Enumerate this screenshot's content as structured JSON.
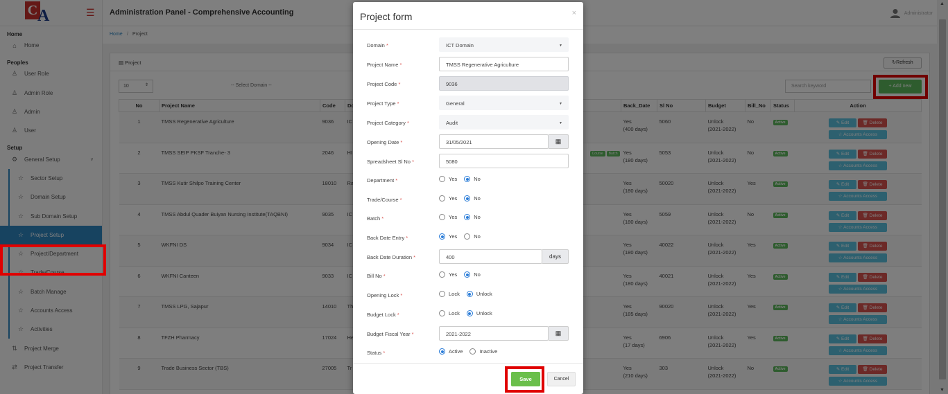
{
  "app": {
    "title": "Administration Panel - Comprehensive Accounting",
    "user": "Administrator",
    "logo_c": "C",
    "logo_a": "A"
  },
  "breadcrumb": {
    "home": "Home",
    "sep": "/",
    "current": "Project"
  },
  "sidebar": {
    "sections": {
      "home": "Home",
      "peoples": "Peoples",
      "setup": "Setup"
    },
    "items": {
      "home": "Home",
      "user_role": "User Role",
      "admin_role": "Admin Role",
      "admin": "Admin",
      "user": "User",
      "general_setup": "General Setup",
      "sector_setup": "Sector Setup",
      "domain_setup": "Domain Setup",
      "sub_domain_setup": "Sub Domain Setup",
      "project_setup": "Project Setup",
      "project_department": "Project/Department",
      "trade_course": "Trade/Course",
      "batch_manage": "Batch Manage",
      "accounts_access": "Accounts Access",
      "activities": "Activities",
      "project_merge": "Project Merge",
      "project_transfer": "Project Transfer"
    }
  },
  "panel": {
    "title": "Project",
    "refresh": "Refresh",
    "page_size": "10",
    "domain_select": "-- Select Domain --",
    "search_placeholder": "Search keyword",
    "add_new": "+ Add new"
  },
  "table": {
    "headers": {
      "no": "No",
      "name": "Project Name",
      "code": "Code",
      "do": "Do",
      "back_date": "Back_Date",
      "sl_no": "Sl No",
      "budget": "Budget",
      "bill_no": "Bill_No",
      "status": "Status",
      "action": "Action"
    },
    "buttons": {
      "edit": "Edit",
      "delete": "Delete",
      "accounts": "Accounts Access"
    },
    "rows": [
      {
        "no": "1",
        "name": "TMSS Regenerative Agriculture",
        "code": "9036",
        "do": "IC",
        "back": "Yes",
        "days": "(400 days)",
        "sl": "5060",
        "budget": "Unlock",
        "fy": "(2021-2022)",
        "bill": "No",
        "status": "Active"
      },
      {
        "no": "2",
        "name": "TMSS SEIP PKSF Tranche- 3",
        "code": "2046",
        "do": "HI",
        "tag1": "Course",
        "tag2": "Batch",
        "back": "Yes",
        "days": "(180 days)",
        "sl": "5053",
        "budget": "Unlock",
        "fy": "(2021-2022)",
        "bill": "No",
        "status": "Active"
      },
      {
        "no": "3",
        "name": "TMSS Kutir Shilpo Training Center",
        "code": "18010",
        "do": "Ra",
        "back": "Yes",
        "days": "(180 days)",
        "sl": "50020",
        "budget": "Unlock",
        "fy": "(2021-2022)",
        "bill": "Yes",
        "status": "Active"
      },
      {
        "no": "4",
        "name": "TMSS Abdul Quader Buiyan Nursing Institute(TAQBNI)",
        "code": "9035",
        "do": "IC",
        "back": "Yes",
        "days": "(180 days)",
        "sl": "5059",
        "budget": "Unlock",
        "fy": "(2021-2022)",
        "bill": "No",
        "status": "Active"
      },
      {
        "no": "5",
        "name": "WKFNI DS",
        "code": "9034",
        "do": "IC",
        "back": "Yes",
        "days": "(180 days)",
        "sl": "40022",
        "budget": "Unlock",
        "fy": "(2021-2022)",
        "bill": "Yes",
        "status": "Active"
      },
      {
        "no": "6",
        "name": "WKFNI Canteen",
        "code": "9033",
        "do": "IC",
        "back": "Yes",
        "days": "(180 days)",
        "sl": "40021",
        "budget": "Unlock",
        "fy": "(2021-2022)",
        "bill": "Yes",
        "status": "Active"
      },
      {
        "no": "7",
        "name": "TMSS LPG, Sajapur",
        "code": "14010",
        "do": "Th",
        "back": "Yes",
        "days": "(185 days)",
        "sl": "90020",
        "budget": "Unlock",
        "fy": "(2021-2022)",
        "bill": "Yes",
        "status": "Active"
      },
      {
        "no": "8",
        "name": "TFZH Pharmacy",
        "code": "17024",
        "do": "He",
        "back": "Yes",
        "days": "(17 days)",
        "sl": "6906",
        "budget": "Unlock",
        "fy": "(2021-2022)",
        "bill": "Yes",
        "status": "Active"
      },
      {
        "no": "9",
        "name": "Trade Business Sector (TBS)",
        "code": "27005",
        "do": "Tr",
        "back": "Yes",
        "days": "(210 days)",
        "sl": "303",
        "budget": "Unlock",
        "fy": "(2021-2022)",
        "bill": "No",
        "status": "Active"
      }
    ]
  },
  "modal": {
    "title": "Project form",
    "close": "×",
    "fields": {
      "domain": {
        "label": "Domain",
        "value": "ICT Domain"
      },
      "project_name": {
        "label": "Project Name",
        "value": "TMSS Regenerative Agriculture"
      },
      "project_code": {
        "label": "Project Code",
        "value": "9036"
      },
      "project_type": {
        "label": "Project Type",
        "value": "General"
      },
      "project_category": {
        "label": "Project Category",
        "value": "Audit"
      },
      "opening_date": {
        "label": "Opening Date",
        "value": "31/05/2021"
      },
      "spreadsheet_sl": {
        "label": "Spreadsheet Sl No",
        "value": "5080"
      },
      "department": {
        "label": "Department"
      },
      "trade_course": {
        "label": "Trade/Course"
      },
      "batch": {
        "label": "Batch"
      },
      "back_date_entry": {
        "label": "Back Date Entry"
      },
      "back_date_duration": {
        "label": "Back Date Duration",
        "value": "400",
        "addon": "days"
      },
      "bill_no": {
        "label": "Bill No"
      },
      "opening_lock": {
        "label": "Opening Lock"
      },
      "budget_lock": {
        "label": "Budget Lock"
      },
      "budget_fiscal_year": {
        "label": "Budget Fiscal Year",
        "value": "2021-2022"
      },
      "status": {
        "label": "Status"
      }
    },
    "options": {
      "yes": "Yes",
      "no": "No",
      "lock": "Lock",
      "unlock": "Unlock",
      "active": "Active",
      "inactive": "Inactive"
    },
    "required_mark": "*",
    "save": "Save",
    "cancel": "Cancel"
  },
  "colors": {
    "primary": "#2e86c1",
    "success": "#5cb85c",
    "danger": "#d9534f",
    "info": "#5bc0de",
    "highlight": "#e00000"
  }
}
